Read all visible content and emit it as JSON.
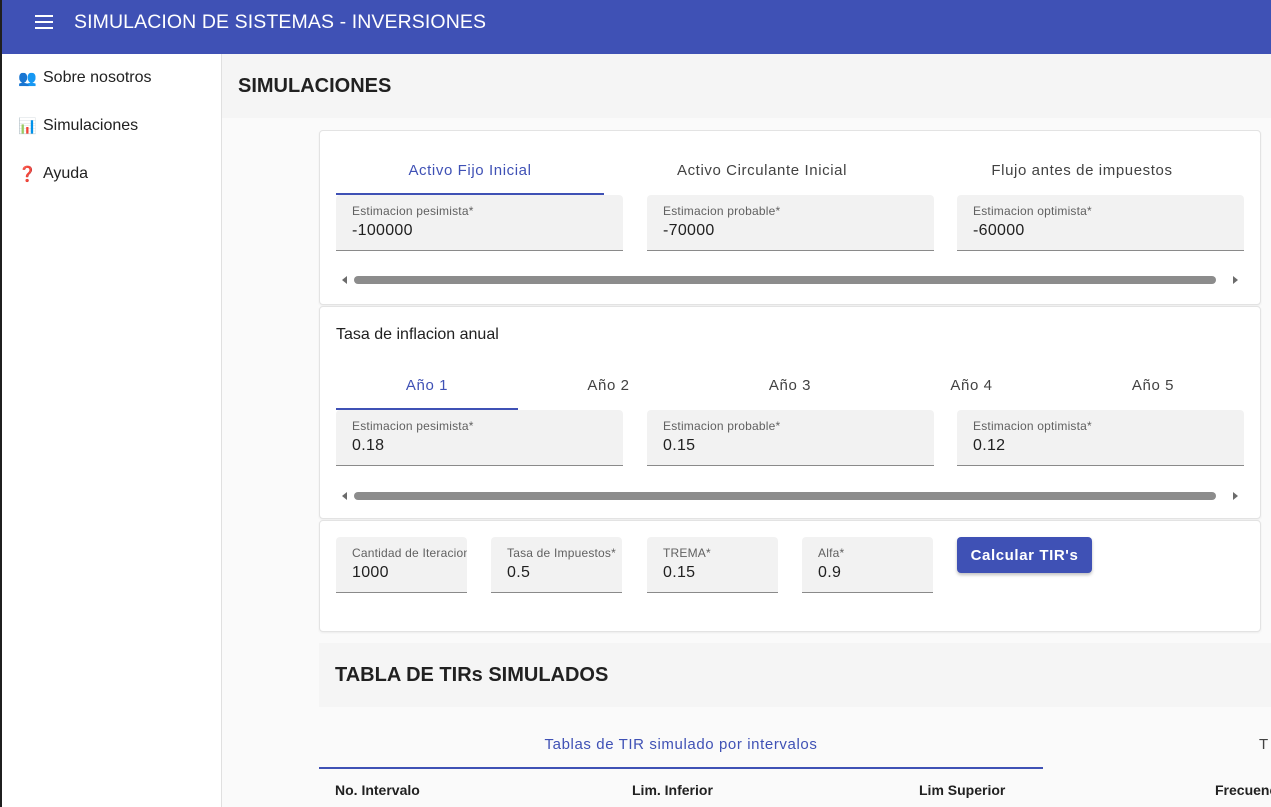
{
  "app": {
    "title": "SIMULACION DE SISTEMAS - INVERSIONES"
  },
  "sidebar": {
    "items": [
      {
        "icon": "👥",
        "icon_name": "people-icon",
        "label": "Sobre nosotros"
      },
      {
        "icon": "📊",
        "icon_name": "bar-chart-icon",
        "label": "Simulaciones"
      },
      {
        "icon": "❓",
        "icon_name": "question-icon",
        "label": "Ayuda"
      }
    ]
  },
  "page": {
    "title": "SIMULACIONES"
  },
  "activos": {
    "tabs": [
      "Activo Fijo Inicial",
      "Activo Circulante Inicial",
      "Flujo antes de impuestos"
    ],
    "active_tab": 0,
    "fields": [
      {
        "label": "Estimacion pesimista*",
        "value": "-100000"
      },
      {
        "label": "Estimacion probable*",
        "value": "-70000"
      },
      {
        "label": "Estimacion optimista*",
        "value": "-60000"
      }
    ]
  },
  "inflacion": {
    "title": "Tasa de inflacion anual",
    "tabs": [
      "Año 1",
      "Año 2",
      "Año 3",
      "Año 4",
      "Año 5"
    ],
    "active_tab": 0,
    "fields": [
      {
        "label": "Estimacion pesimista*",
        "value": "0.18"
      },
      {
        "label": "Estimacion probable*",
        "value": "0.15"
      },
      {
        "label": "Estimacion optimista*",
        "value": "0.12"
      }
    ]
  },
  "params": {
    "fields": [
      {
        "label": "Cantidad de Iteraciones*",
        "value": "1000"
      },
      {
        "label": "Tasa de Impuestos*",
        "value": "0.5"
      },
      {
        "label": "TREMA*",
        "value": "0.15"
      },
      {
        "label": "Alfa*",
        "value": "0.9"
      }
    ],
    "button": "Calcular TIR's"
  },
  "results": {
    "title": "TABLA DE TIRs SIMULADOS",
    "tabs": [
      "Tablas de TIR simulado por intervalos",
      "T"
    ],
    "columns": [
      "No. Intervalo",
      "Lim. Inferior",
      "Lim Superior",
      "Frecuencia"
    ]
  },
  "colors": {
    "primary": "#3f51b5",
    "field_bg": "#f2f2f2"
  }
}
